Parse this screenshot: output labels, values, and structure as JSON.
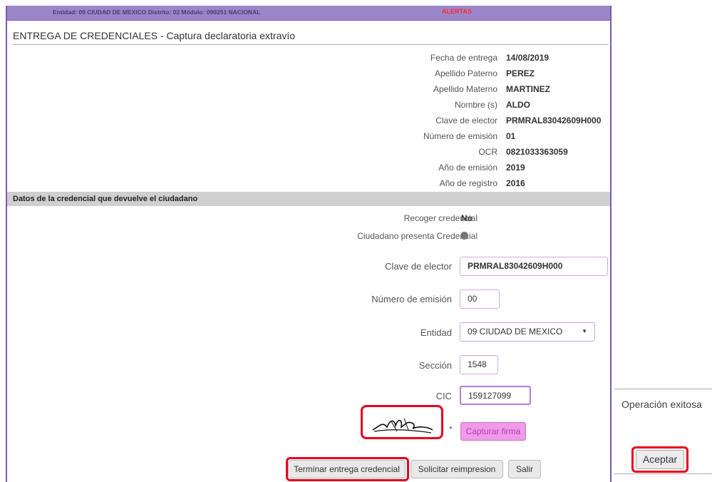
{
  "topbar": {
    "info": "Entidad: 09 CIUDAD DE MEXICO Distrito: 02 Módulo: 090251 NACIONAL",
    "alerts": "ALERTAS"
  },
  "page_title": "ENTREGA DE CREDENCIALES - Captura declaratoria extravío",
  "summary": [
    {
      "label": "Fecha de entrega",
      "value": "14/08/2019"
    },
    {
      "label": "Apellido Paterno",
      "value": "PEREZ"
    },
    {
      "label": "Apellido Materno",
      "value": "MARTINEZ"
    },
    {
      "label": "Nombre (s)",
      "value": "ALDO"
    },
    {
      "label": "Clave de elector",
      "value": "PRMRAL83042609H000"
    },
    {
      "label": "Número de emisión",
      "value": "01"
    },
    {
      "label": "OCR",
      "value": "0821033363059"
    },
    {
      "label": "Año de emisión",
      "value": "2019"
    },
    {
      "label": "Año de registro",
      "value": "2016"
    }
  ],
  "section_title": "Datos de la credencial que devuelve el ciudadano",
  "recoger": {
    "label": "Recoger credencial",
    "value": "No"
  },
  "presenta_label": "Ciudadano presenta Credencial",
  "form": {
    "clave_label": "Clave de elector",
    "clave_value": "PRMRAL83042609H000",
    "emision_label": "Número de emisión",
    "emision_value": "00",
    "entidad_label": "Entidad",
    "entidad_value": "09 CIUDAD DE MEXICO",
    "seccion_label": "Sección",
    "seccion_value": "1548",
    "cic_label": "CIC",
    "cic_value": "159127099",
    "asterisk": "*",
    "capturar_firma": "Capturar firma"
  },
  "buttons": {
    "terminar": "Terminar entrega credencial",
    "reimpresion": "Solicitar reimpresion",
    "salir": "Salir"
  },
  "dialog": {
    "message": "Operación exitosa",
    "accept": "Aceptar"
  },
  "colors": {
    "topbar": "#9b86c9",
    "frame_border": "#7b59b5",
    "highlight": "#e8001c",
    "firma_button": "#ef9be9"
  }
}
